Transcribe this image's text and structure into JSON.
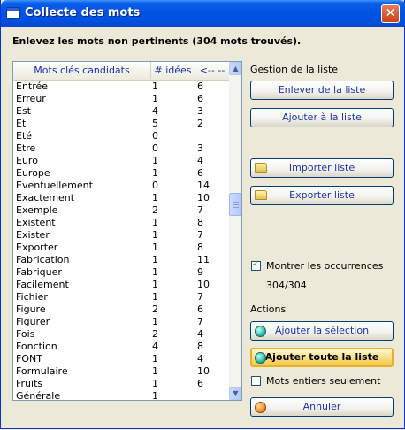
{
  "window": {
    "title": "Collecte des mots",
    "close_glyph": "✕"
  },
  "heading": "Enlevez les mots non pertinents (304 mots trouvés).",
  "list": {
    "columns": [
      "Mots clés candidats",
      "# idées",
      "<-- --"
    ],
    "rows": [
      {
        "word": "Entrée",
        "ideas": "1",
        "occ": "6"
      },
      {
        "word": "Erreur",
        "ideas": "1",
        "occ": "6"
      },
      {
        "word": "Est",
        "ideas": "4",
        "occ": "3"
      },
      {
        "word": "Et",
        "ideas": "5",
        "occ": "2"
      },
      {
        "word": "Eté",
        "ideas": "0",
        "occ": ""
      },
      {
        "word": "Etre",
        "ideas": "0",
        "occ": "3"
      },
      {
        "word": "Euro",
        "ideas": "1",
        "occ": "4"
      },
      {
        "word": "Europe",
        "ideas": "1",
        "occ": "6"
      },
      {
        "word": "Eventuellement",
        "ideas": "0",
        "occ": "14"
      },
      {
        "word": "Exactement",
        "ideas": "1",
        "occ": "10"
      },
      {
        "word": "Exemple",
        "ideas": "2",
        "occ": "7"
      },
      {
        "word": "Existent",
        "ideas": "1",
        "occ": "8"
      },
      {
        "word": "Exister",
        "ideas": "1",
        "occ": "7"
      },
      {
        "word": "Exporter",
        "ideas": "1",
        "occ": "8"
      },
      {
        "word": "Fabrication",
        "ideas": "1",
        "occ": "11"
      },
      {
        "word": "Fabriquer",
        "ideas": "1",
        "occ": "9"
      },
      {
        "word": "Facilement",
        "ideas": "1",
        "occ": "10"
      },
      {
        "word": "Fichier",
        "ideas": "1",
        "occ": "7"
      },
      {
        "word": "Figure",
        "ideas": "2",
        "occ": "6"
      },
      {
        "word": "Figurer",
        "ideas": "1",
        "occ": "7"
      },
      {
        "word": "Fois",
        "ideas": "2",
        "occ": "4"
      },
      {
        "word": "Fonction",
        "ideas": "4",
        "occ": "8"
      },
      {
        "word": "FONT",
        "ideas": "1",
        "occ": "4"
      },
      {
        "word": "Formulaire",
        "ideas": "1",
        "occ": "10"
      },
      {
        "word": "Fruits",
        "ideas": "1",
        "occ": "6"
      },
      {
        "word": "Générale",
        "ideas": "1",
        "occ": ""
      }
    ]
  },
  "gestion": {
    "label": "Gestion de la liste",
    "remove": "Enlever de la liste",
    "add": "Ajouter à la liste",
    "import": "Importer liste",
    "export": "Exporter liste"
  },
  "occurrences": {
    "label": "Montrer les occurrences",
    "checked": true,
    "count": "304/304"
  },
  "actions": {
    "label": "Actions",
    "add_selection": "Ajouter la sélection",
    "add_all": "Ajouter toute la liste",
    "whole_words": "Mots entiers seulement",
    "cancel": "Annuler"
  },
  "icons": {
    "scroll_up": "▲",
    "scroll_down": "▼"
  }
}
